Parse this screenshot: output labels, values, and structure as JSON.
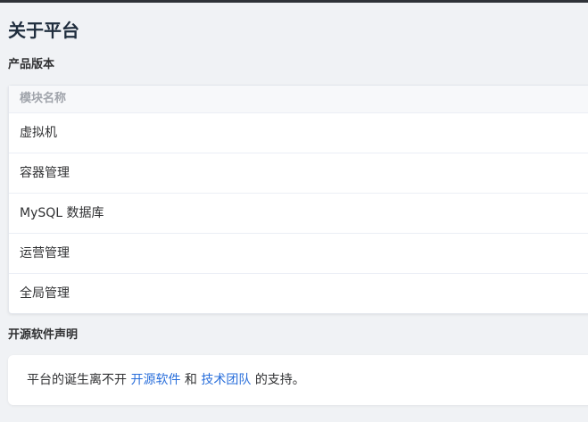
{
  "page": {
    "title": "关于平台"
  },
  "product_version": {
    "section_title": "产品版本",
    "table": {
      "column_header": "模块名称",
      "rows": [
        "虚拟机",
        "容器管理",
        "MySQL 数据库",
        "运营管理",
        "全局管理"
      ]
    }
  },
  "open_source": {
    "section_title": "开源软件声明",
    "text_before": "平台的诞生离不开",
    "link1": "开源软件",
    "text_middle": "和",
    "link2": "技术团队",
    "text_after": "的支持。"
  },
  "colors": {
    "link": "#2a6fdb",
    "background": "#f0f2f5",
    "topbar": "#2f3238"
  }
}
